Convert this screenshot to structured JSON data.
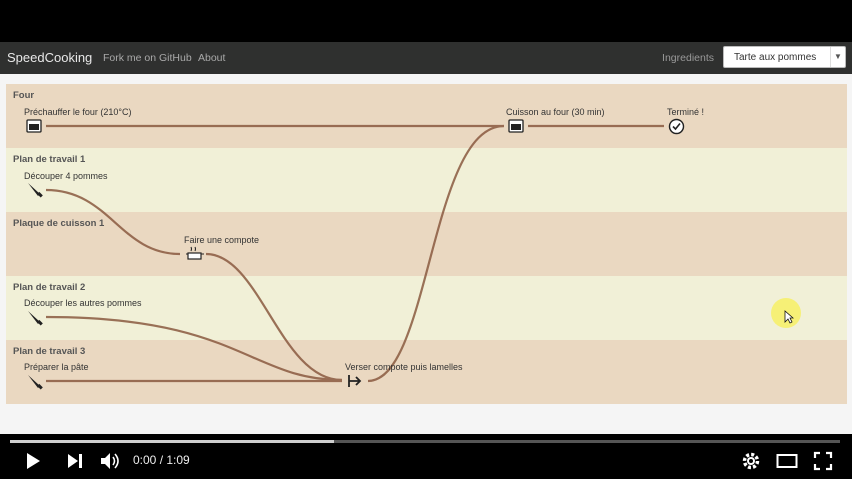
{
  "navbar": {
    "brand": "SpeedCooking",
    "links": [
      "Fork me on GitHub",
      "About"
    ],
    "ingredients_label": "Ingredients",
    "recipe_select_value": "Tarte aux pommes"
  },
  "lanes": [
    {
      "title": "Four"
    },
    {
      "title": "Plan de travail 1"
    },
    {
      "title": "Plaque de cuisson 1"
    },
    {
      "title": "Plan de travail 2"
    },
    {
      "title": "Plan de travail 3"
    }
  ],
  "steps": {
    "preheat": "Préchauffer le four (210°C)",
    "bake": "Cuisson au four (30 min)",
    "done": "Terminé !",
    "cut4": "Découper 4 pommes",
    "compote": "Faire une compote",
    "cut_rest": "Découper les autres pommes",
    "dough": "Préparer la pâte",
    "pour": "Verser compote puis lamelles"
  },
  "player": {
    "time": "0:00 / 1:09",
    "progress_fraction": 0.39
  },
  "colors": {
    "lane_odd": "#ead8c1",
    "lane_even": "#f1f0d7",
    "flow_line": "#8a5a40",
    "navbar": "#2f302f"
  },
  "icons": {
    "oven": "oven-icon",
    "knife": "knife-icon",
    "pot": "pot-icon",
    "pour": "pour-icon",
    "check": "check-circle-icon"
  }
}
